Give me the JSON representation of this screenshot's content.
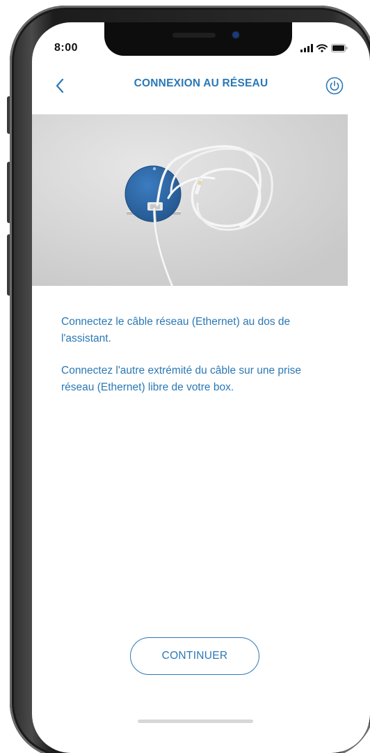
{
  "status_bar": {
    "time": "8:00",
    "icons": [
      "signal-icon",
      "wifi-icon",
      "battery-icon"
    ]
  },
  "nav": {
    "title": "CONNEXION AU RÉSEAU",
    "back_icon": "chevron-left-icon",
    "power_icon": "power-icon"
  },
  "instructions": {
    "step1": "Connectez le câble réseau (Ethernet) au dos de l'assistant.",
    "step2": "Connectez l'autre extrémité du câble sur une prise réseau (Ethernet) libre de votre box."
  },
  "actions": {
    "continue_label": "CONTINUER"
  },
  "colors": {
    "accent": "#2b78b5",
    "device_blue": "#2f6cae",
    "background": "#ffffff"
  }
}
